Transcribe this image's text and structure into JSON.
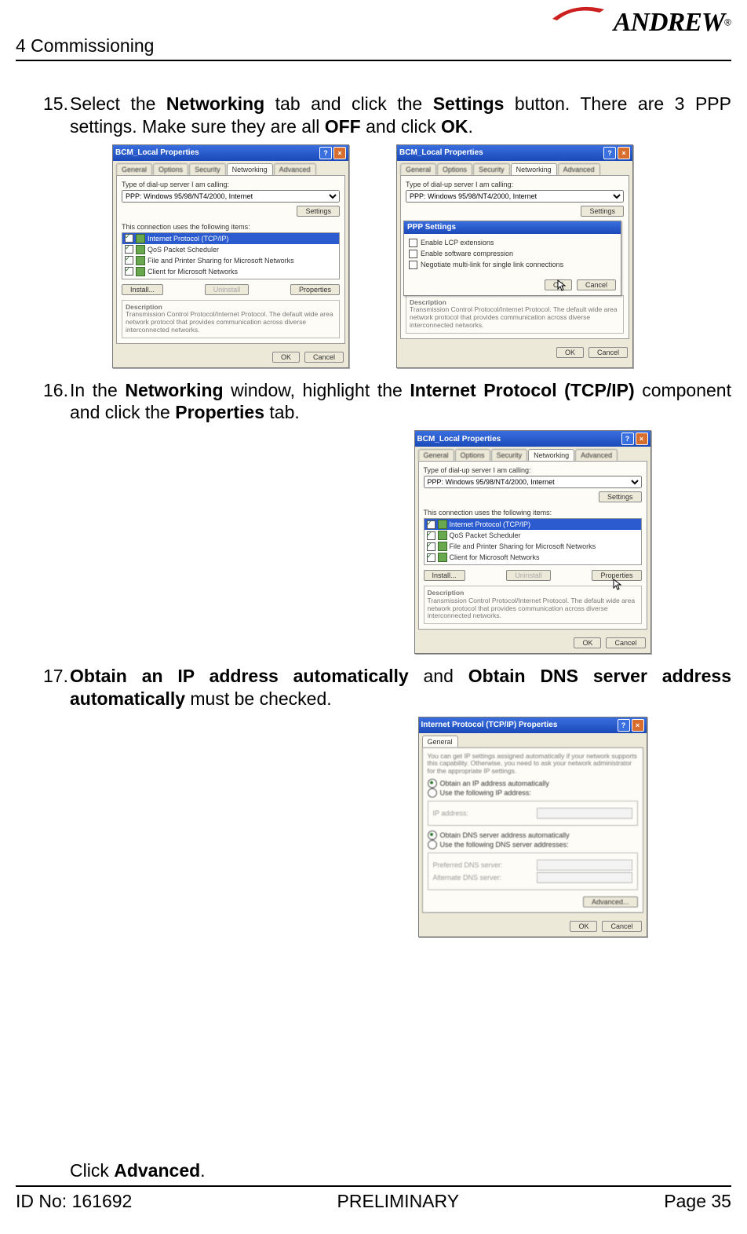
{
  "header": {
    "chapter": "4 Commissioning",
    "brand": "ANDREW",
    "reg": "®"
  },
  "footer": {
    "id": "ID No: 161692",
    "status": "PRELIMINARY",
    "page": "Page 35"
  },
  "steps": {
    "s15": {
      "num": "15.",
      "p1": "Select the ",
      "b1": "Networking",
      "p2": " tab and click the ",
      "b2": "Settings",
      "p3": " button. There are 3 PPP settings. Make sure they are all ",
      "b3": "OFF",
      "p4": " and click ",
      "b4": "OK",
      "p5": "."
    },
    "s16": {
      "num": "16.",
      "p1": "In the ",
      "b1": "Networking",
      "p2": " window, highlight the ",
      "b2": "Internet Protocol (TCP/IP)",
      "p3": " component and click the ",
      "b3": "Properties",
      "p4": " tab."
    },
    "s17": {
      "num": "17.",
      "b1": "Obtain an IP address automatically",
      "p1": " and ",
      "b2": "Obtain DNS server address automatically",
      "p2": " must be checked."
    },
    "clickadv": {
      "p1": "Click ",
      "b1": "Advanced",
      "p2": "."
    }
  },
  "dlg": {
    "title": "BCM_Local Properties",
    "tabs": [
      "General",
      "Options",
      "Security",
      "Networking",
      "Advanced"
    ],
    "typelabel": "Type of dial-up server I am calling:",
    "combo": "PPP: Windows 95/98/NT4/2000, Internet",
    "settingsBtn": "Settings",
    "usesLabel": "This connection uses the following items:",
    "items": [
      "Internet Protocol (TCP/IP)",
      "QoS Packet Scheduler",
      "File and Printer Sharing for Microsoft Networks",
      "Client for Microsoft Networks"
    ],
    "install": "Install...",
    "uninstall": "Uninstall",
    "properties": "Properties",
    "descTitle": "Description",
    "desc": "Transmission Control Protocol/Internet Protocol. The default wide area network protocol that provides communication across diverse interconnected networks.",
    "ok": "OK",
    "cancel": "Cancel"
  },
  "ppp": {
    "title": "PPP Settings",
    "opts": [
      "Enable LCP extensions",
      "Enable software compression",
      "Negotiate multi-link for single link connections"
    ],
    "ok": "OK",
    "cancel": "Cancel"
  },
  "tcpip": {
    "title": "Internet Protocol (TCP/IP) Properties",
    "tab": "General",
    "para": "You can get IP settings assigned automatically if your network supports this capability. Otherwise, you need to ask your network administrator for the appropriate IP settings.",
    "r1": "Obtain an IP address automatically",
    "r2": "Use the following IP address:",
    "f1": "IP address:",
    "r3": "Obtain DNS server address automatically",
    "r4": "Use the following DNS server addresses:",
    "f2": "Preferred DNS server:",
    "f3": "Alternate DNS server:",
    "adv": "Advanced...",
    "ok": "OK",
    "cancel": "Cancel"
  }
}
